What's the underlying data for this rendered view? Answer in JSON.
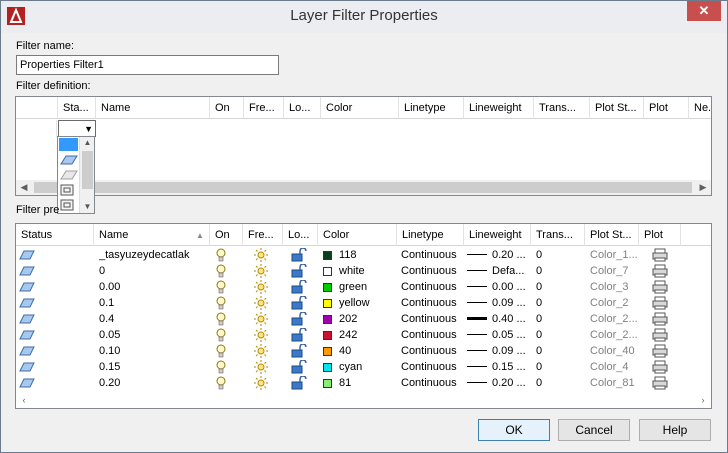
{
  "window": {
    "title": "Layer Filter Properties",
    "close": "✕"
  },
  "filter_name": {
    "label": "Filter name:",
    "value": "Properties Filter1"
  },
  "filter_definition": {
    "label": "Filter definition:",
    "columns": [
      "Sta...",
      "Name",
      "On",
      "Fre...",
      "Lo...",
      "Color",
      "Linetype",
      "Lineweight",
      "Trans...",
      "Plot St...",
      "Plot",
      "Ne..."
    ]
  },
  "filter_preview": {
    "label": "Filter pre",
    "columns": [
      "Status",
      "Name",
      "On",
      "Fre...",
      "Lo...",
      "Color",
      "Linetype",
      "Lineweight",
      "Trans...",
      "Plot St...",
      "Plot"
    ],
    "rows": [
      {
        "name": "_tasyuzeydecatlak",
        "color_name": "118",
        "color_hex": "#0d3f1b",
        "linetype": "Continuous",
        "lw_text": "0.20 ...",
        "lw_thick": false,
        "trans": "0",
        "plot_style": "Color_1..."
      },
      {
        "name": "0",
        "color_name": "white",
        "color_hex": "#ffffff",
        "linetype": "Continuous",
        "lw_text": "Defa...",
        "lw_thick": false,
        "trans": "0",
        "plot_style": "Color_7"
      },
      {
        "name": "0.00",
        "color_name": "green",
        "color_hex": "#00cc00",
        "linetype": "Continuous",
        "lw_text": "0.00 ...",
        "lw_thick": false,
        "trans": "0",
        "plot_style": "Color_3"
      },
      {
        "name": "0.1",
        "color_name": "yellow",
        "color_hex": "#ffff00",
        "linetype": "Continuous",
        "lw_text": "0.09 ...",
        "lw_thick": false,
        "trans": "0",
        "plot_style": "Color_2"
      },
      {
        "name": "0.4",
        "color_name": "202",
        "color_hex": "#a000b0",
        "linetype": "Continuous",
        "lw_text": "0.40 ...",
        "lw_thick": true,
        "trans": "0",
        "plot_style": "Color_2..."
      },
      {
        "name": "0.05",
        "color_name": "242",
        "color_hex": "#cc1133",
        "linetype": "Continuous",
        "lw_text": "0.05 ...",
        "lw_thick": false,
        "trans": "0",
        "plot_style": "Color_2..."
      },
      {
        "name": "0.10",
        "color_name": "40",
        "color_hex": "#ff9900",
        "linetype": "Continuous",
        "lw_text": "0.09 ...",
        "lw_thick": false,
        "trans": "0",
        "plot_style": "Color_40"
      },
      {
        "name": "0.15",
        "color_name": "cyan",
        "color_hex": "#00e5ee",
        "linetype": "Continuous",
        "lw_text": "0.15 ...",
        "lw_thick": false,
        "trans": "0",
        "plot_style": "Color_4"
      },
      {
        "name": "0.20",
        "color_name": "81",
        "color_hex": "#88ee77",
        "linetype": "Continuous",
        "lw_text": "0.20 ...",
        "lw_thick": false,
        "trans": "0",
        "plot_style": "Color_81"
      }
    ]
  },
  "buttons": {
    "ok": "OK",
    "cancel": "Cancel",
    "help": "Help"
  },
  "icons": {
    "status": "layer-status-icon",
    "on": "lightbulb-icon",
    "freeze": "sun-icon",
    "lock": "unlock-icon",
    "plot": "printer-icon"
  },
  "colors": {
    "close_button": "#c7504f",
    "selection": "#3399ff"
  }
}
